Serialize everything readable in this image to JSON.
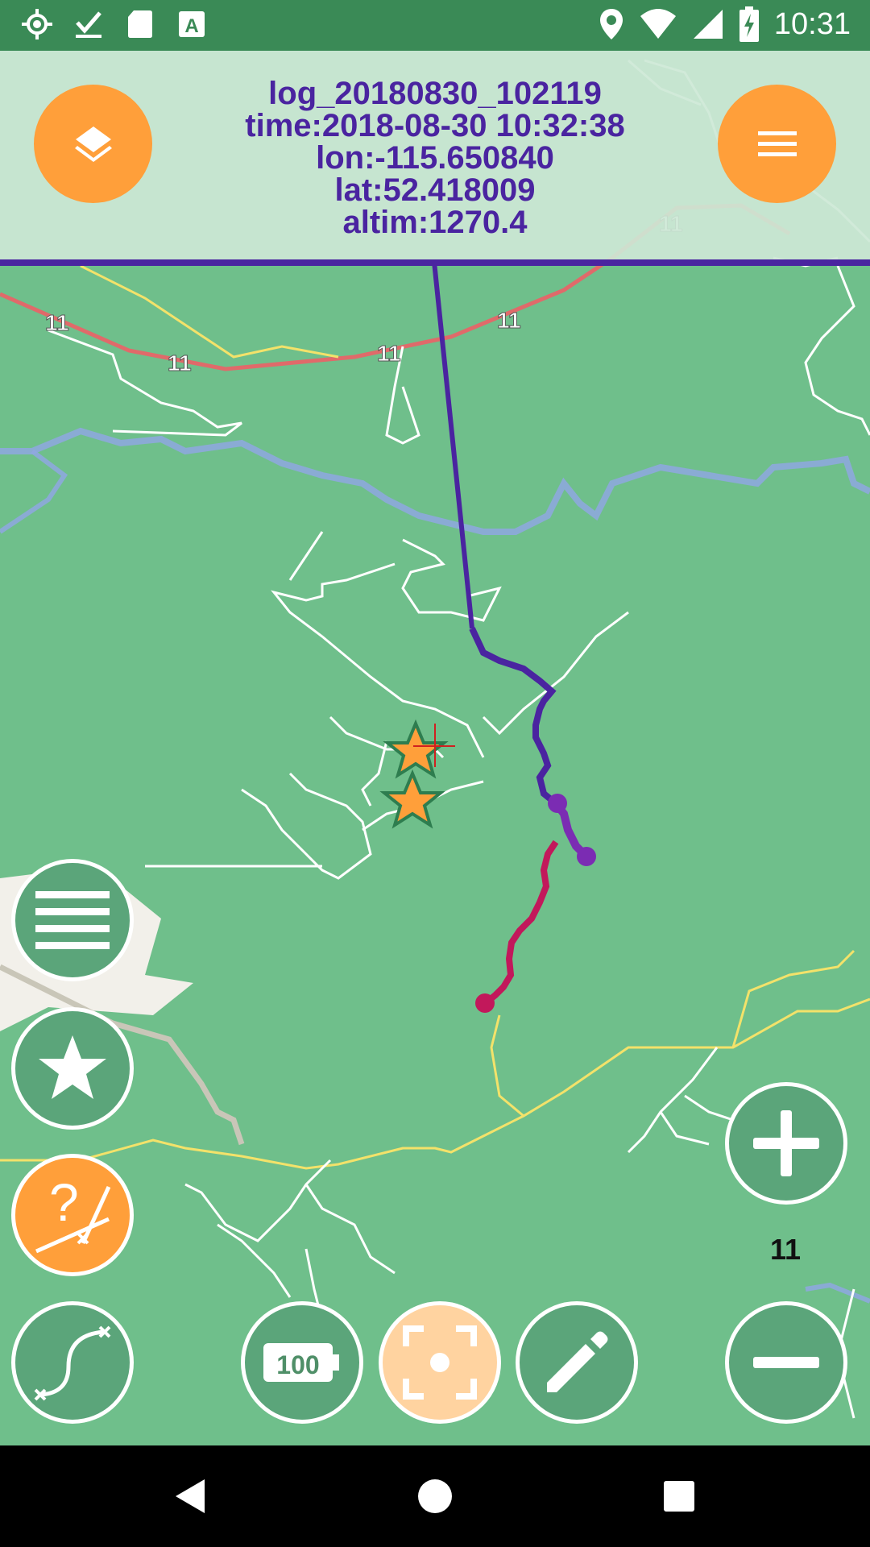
{
  "status_bar": {
    "time": "10:31",
    "left_icons": [
      "gps-target-icon",
      "check-download-icon",
      "sd-card-icon",
      "keyboard-a-icon"
    ],
    "right_icons": [
      "location-pin-icon",
      "wifi-icon",
      "signal-icon",
      "battery-charging-icon"
    ]
  },
  "info_panel": {
    "log_name": "log_20180830_102119",
    "time": "time:2018-08-30 10:32:38",
    "lon": "lon:-115.650840",
    "lat": "lat:52.418009",
    "altim": "altim:1270.4"
  },
  "map": {
    "road_labels": [
      "11",
      "11",
      "11",
      "11",
      "11",
      "11"
    ],
    "colors": {
      "background": "#6fbf8b",
      "track_primary": "#4a24a0",
      "track_purple": "#7b2cb3",
      "track_red": "#c2185b",
      "highway": "#e06a6a",
      "river": "#8fa7e0",
      "trail": "#ffffff",
      "yellow_road": "#f3e26a",
      "accent_orange": "#ff9f3a"
    }
  },
  "controls": {
    "zoom_level": "11",
    "battery_label": "100",
    "buttons": [
      "layers",
      "menu",
      "list",
      "bookmark",
      "gps-help",
      "track-curve",
      "battery",
      "center-location",
      "edit",
      "zoom-in",
      "zoom-out"
    ]
  },
  "nav_bar": {
    "icons": [
      "back-icon",
      "home-icon",
      "recents-icon"
    ]
  }
}
